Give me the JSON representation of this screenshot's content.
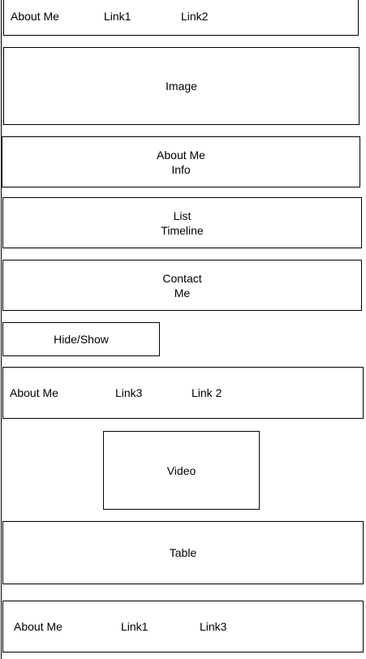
{
  "top_nav": {
    "about": "About Me",
    "link1": "Link1",
    "link2": "Link2"
  },
  "image_block": {
    "label": "Image"
  },
  "about_info_block": {
    "line1": "About Me",
    "line2": "Info"
  },
  "list_timeline_block": {
    "line1": "List",
    "line2": "Timeline"
  },
  "contact_block": {
    "line1": "Contact",
    "line2": "Me"
  },
  "hide_show_button": {
    "label": "Hide/Show"
  },
  "middle_nav": {
    "about": "About Me",
    "link3": "Link3",
    "link2": "Link 2"
  },
  "video_block": {
    "label": "Video"
  },
  "table_block": {
    "label": "Table"
  },
  "footer_nav": {
    "about": "About Me",
    "link1": "Link1",
    "link3": "Link3"
  }
}
